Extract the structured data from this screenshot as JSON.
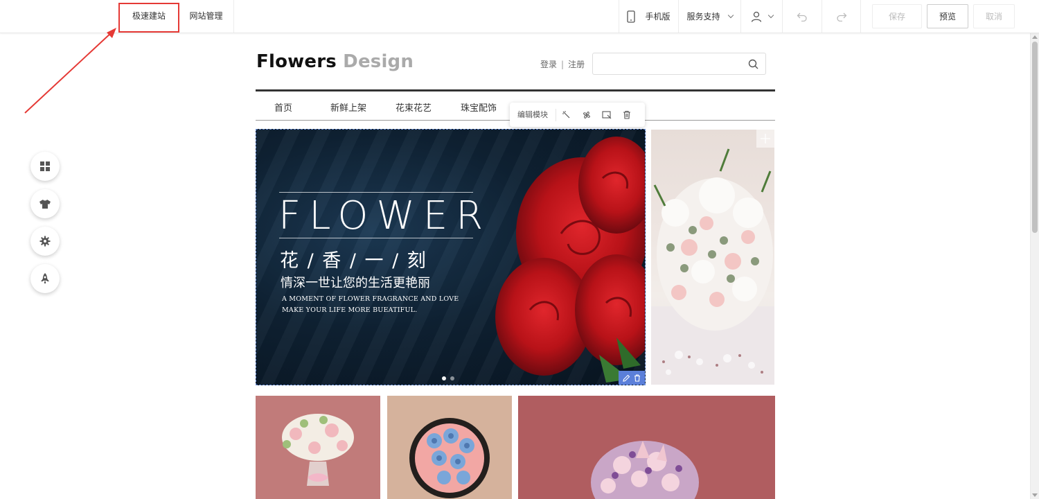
{
  "topbar": {
    "tabs": [
      "极速建站",
      "网站管理"
    ],
    "mobile_label": "手机版",
    "service_label": "服务支持",
    "save_label": "保存",
    "preview_label": "预览",
    "cancel_label": "取消"
  },
  "site": {
    "logo_bold": "Flowers",
    "logo_light": "Design",
    "login": "登录",
    "divider": "|",
    "register": "注册",
    "search_placeholder": "",
    "nav": [
      "首页",
      "新鲜上架",
      "花束花艺",
      "珠宝配饰"
    ],
    "module_toolbar_label": "编辑模块",
    "banner": {
      "title": "FLOWER",
      "cn_title": "花 / 香 / 一 / 刻",
      "cn_sub": "情深一世让您的生活更艳丽",
      "en_line1": "A MOMENT OF FLOWER FRAGRANCE AND LOVE",
      "en_line2": "MAKE YOUR LIFE MORE BUEATIFUL.",
      "slides_total": 2,
      "active_slide": 1
    }
  },
  "colors": {
    "annotation": "#e53935",
    "selection": "#5b7fd9"
  }
}
